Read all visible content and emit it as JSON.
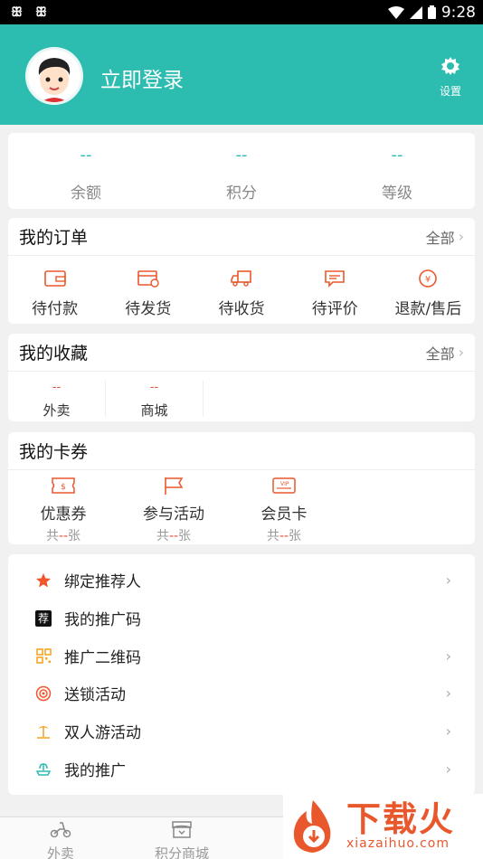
{
  "status_bar": {
    "time": "9:28"
  },
  "header": {
    "login_text": "立即登录",
    "settings_label": "设置"
  },
  "stats": [
    {
      "value": "--",
      "label": "余额"
    },
    {
      "value": "--",
      "label": "积分"
    },
    {
      "value": "--",
      "label": "等级"
    }
  ],
  "orders": {
    "title": "我的订单",
    "all_label": "全部",
    "items": [
      {
        "label": "待付款",
        "icon": "wallet-icon"
      },
      {
        "label": "待发货",
        "icon": "package-icon"
      },
      {
        "label": "待收货",
        "icon": "truck-icon"
      },
      {
        "label": "待评价",
        "icon": "comment-icon"
      },
      {
        "label": "退款/售后",
        "icon": "refund-icon"
      }
    ]
  },
  "favorites": {
    "title": "我的收藏",
    "all_label": "全部",
    "items": [
      {
        "value": "--",
        "label": "外卖"
      },
      {
        "value": "--",
        "label": "商城"
      }
    ]
  },
  "coupons": {
    "title": "我的卡券",
    "items": [
      {
        "label": "优惠券",
        "prefix": "共",
        "count": "--",
        "suffix": "张",
        "icon": "coupon-icon"
      },
      {
        "label": "参与活动",
        "prefix": "共",
        "count": "--",
        "suffix": "张",
        "icon": "flag-icon"
      },
      {
        "label": "会员卡",
        "prefix": "共",
        "count": "--",
        "suffix": "张",
        "icon": "vip-card-icon"
      }
    ]
  },
  "menu": [
    {
      "label": "绑定推荐人",
      "icon": "star-icon",
      "chevron": true
    },
    {
      "label": "我的推广码",
      "icon": "recommend-badge-icon",
      "badge": "荐",
      "chevron": false
    },
    {
      "label": "推广二维码",
      "icon": "qrcode-icon",
      "chevron": true
    },
    {
      "label": "送锁活动",
      "icon": "lock-gift-icon",
      "chevron": true
    },
    {
      "label": "双人游活动",
      "icon": "beach-icon",
      "chevron": true
    },
    {
      "label": "我的推广",
      "icon": "fountain-icon",
      "chevron": true
    }
  ],
  "bottom_nav": [
    {
      "label": "外卖",
      "icon": "scooter-icon"
    },
    {
      "label": "积分商城",
      "icon": "shop-icon"
    }
  ],
  "watermark": {
    "title": "下载火",
    "url": "xiazaihuo.com"
  },
  "colors": {
    "teal": "#2cbcb0",
    "orange": "#e9582c",
    "red": "#e94e3c"
  }
}
